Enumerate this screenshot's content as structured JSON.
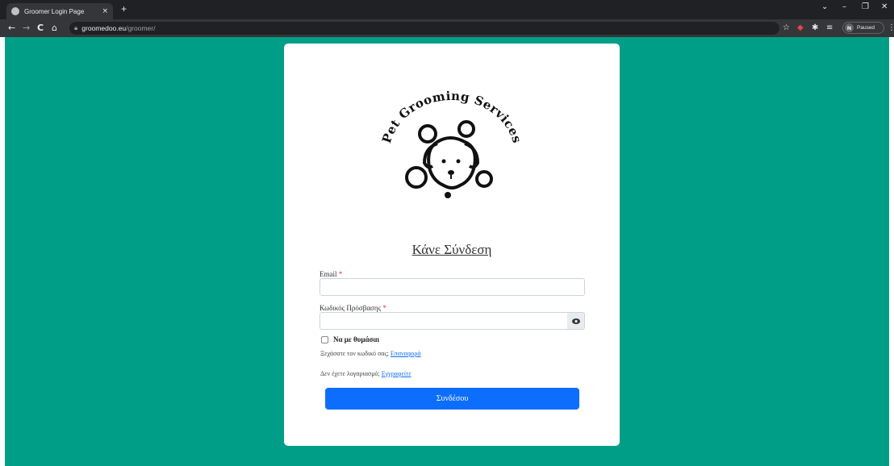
{
  "browser": {
    "tab_title": "Groomer Login Page",
    "tab_close": "×",
    "new_tab": "+",
    "url_host": "groomedoo.eu",
    "url_path": "/groomer/",
    "profile_initial": "N",
    "profile_label": "Paused",
    "win_controls": {
      "chevron": "⌄",
      "minimize": "–",
      "restore": "❐",
      "close": "✕"
    },
    "nav": {
      "back": "←",
      "forward": "→",
      "reload": "C",
      "home": "⌂"
    }
  },
  "page": {
    "background_color": "#009e87",
    "logo_text": "Pet Grooming Services",
    "login_title": "Κάνε Σύνδεση",
    "email_label": "Email",
    "password_label": "Κωδικός Πρόσβασης",
    "required_mark": "*",
    "email_value": "",
    "password_value": "",
    "remember_label": "Να με θυμάσαι",
    "forgot_text": "Ξεχάσατε τον κωδικό σας;",
    "forgot_link": "Επαναφορά",
    "no_account_text": "Δεν έχετε λογαριασμό;",
    "register_link": "Εγγραφείτε",
    "submit_label": "Συνδέσου",
    "accent_color": "#0d6efd",
    "eye_icon": "eye-icon"
  }
}
